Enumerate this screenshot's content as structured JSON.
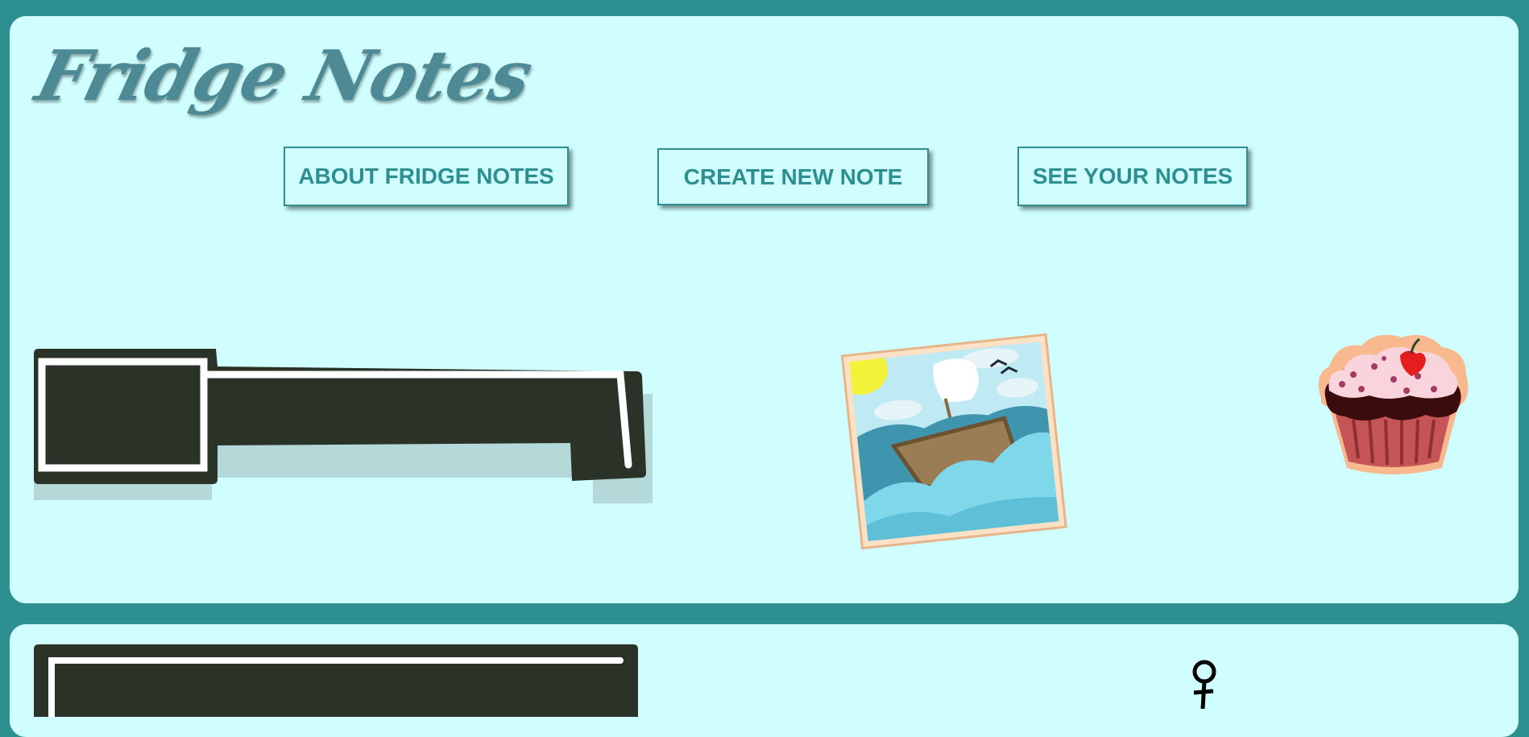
{
  "header": {
    "logo_text": "Fridge Notes"
  },
  "nav": {
    "about_label": "ABOUT FRIDGE NOTES",
    "create_label": "CREATE NEW NOTE",
    "see_label": "SEE YOUR NOTES"
  },
  "colors": {
    "background": "#2d8f8f",
    "panel": "#d0fefe",
    "accent": "#2d8f8f",
    "logo": "#4d8a96",
    "handle": "#2b3329"
  },
  "magnets": [
    {
      "name": "boat-picture",
      "icon": "boat-icon"
    },
    {
      "name": "cupcake",
      "icon": "cupcake-icon"
    },
    {
      "name": "stick-figure",
      "icon": "stick-figure-icon"
    }
  ]
}
